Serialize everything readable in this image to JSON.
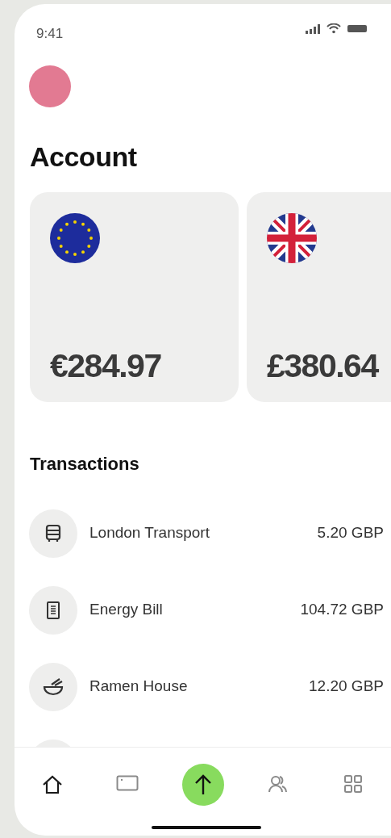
{
  "status_bar": {
    "time": "9:41"
  },
  "title": "Account",
  "accounts": [
    {
      "kind": "eu",
      "balance": "€284.97"
    },
    {
      "kind": "uk",
      "balance": "£380.64"
    }
  ],
  "transactions_title": "Transactions",
  "transactions": [
    {
      "kind": "bus",
      "name": "London Transport",
      "amount": "5.20 GBP"
    },
    {
      "kind": "bill",
      "name": "Energy Bill",
      "amount": "104.72 GBP"
    },
    {
      "kind": "bowl",
      "name": "Ramen House",
      "amount": "12.20 GBP"
    }
  ],
  "nav": [
    {
      "kind": "home",
      "selected": true
    },
    {
      "kind": "card",
      "selected": false
    },
    {
      "kind": "send",
      "selected": false
    },
    {
      "kind": "people",
      "selected": false
    },
    {
      "kind": "grid",
      "selected": false
    }
  ]
}
